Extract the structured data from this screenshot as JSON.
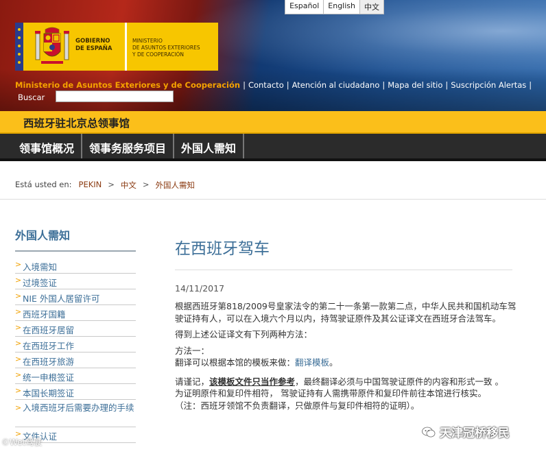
{
  "languages": [
    "Español",
    "English",
    "中文"
  ],
  "gob_text": [
    "GOBIERNO",
    "DE ESPAÑA"
  ],
  "min_text": [
    "MINISTERIO",
    "DE ASUNTOS EXTERIORES",
    "Y DE COOPERACIÓN"
  ],
  "top_links": [
    "Ministerio de Asuntos Exteriores y de Cooperación",
    "Contacto",
    "Atención al ciudadano",
    "Mapa del sitio",
    "Suscripción Alertas"
  ],
  "search": {
    "label": "Buscar",
    "value": ""
  },
  "consulate_title": "西班牙驻北京总领事馆",
  "main_nav": [
    "领事馆概况",
    "领事务服务项目",
    "外国人需知"
  ],
  "breadcrumb": {
    "label": "Está usted en:",
    "items": [
      "PEKIN",
      "中文",
      "外国人需知"
    ]
  },
  "sidebar": {
    "title": "外国人需知",
    "items": [
      "入境需知",
      "过境签证",
      "NIE 外国人居留许可",
      "西班牙国籍",
      "在西班牙居留",
      "在西班牙工作",
      "在西班牙旅游",
      "统一申根签证",
      "本国长期签证",
      "入境西班牙后需要办理的手续",
      "文件认证"
    ]
  },
  "article": {
    "title": "在西班牙驾车",
    "date": "14/11/2017",
    "p1": "根据西班牙第818/2009号皇家法令的第二十一条第一款第二点，中华人民共和国机动车驾驶证持有人，可以在入境六个月以内，持驾驶证原件及其公证译文在西班牙合法驾车。",
    "p2": "得到上述公证译文有下列两种方法：",
    "method1_label": "方法一：",
    "method1_text": "翻译可以根据本馆的模板来做：",
    "method1_link": "翻译模板",
    "method1_end": "。",
    "note_a": "请谨记，",
    "note_b": "该模板文件只当作参考",
    "note_c": "，最终翻译必须与中国驾驶证原件的内容和形式一致 。",
    "note2": "为证明原件和复印件相符， 驾驶证持有人需携带原件和复印件前往本馆进行核实。",
    "note3": "（注：西班牙领馆不负责翻译，只做原件与复印件相符的证明）。"
  },
  "watermark_left": "©Wet驾驶",
  "watermark_right": "天津冠桥移民",
  "colors": {
    "accent_blue": "#3d6f98",
    "banner_yellow": "#fbbf1a",
    "link_brown": "#8a3a10",
    "nav_dark": "#2b2b2b"
  }
}
